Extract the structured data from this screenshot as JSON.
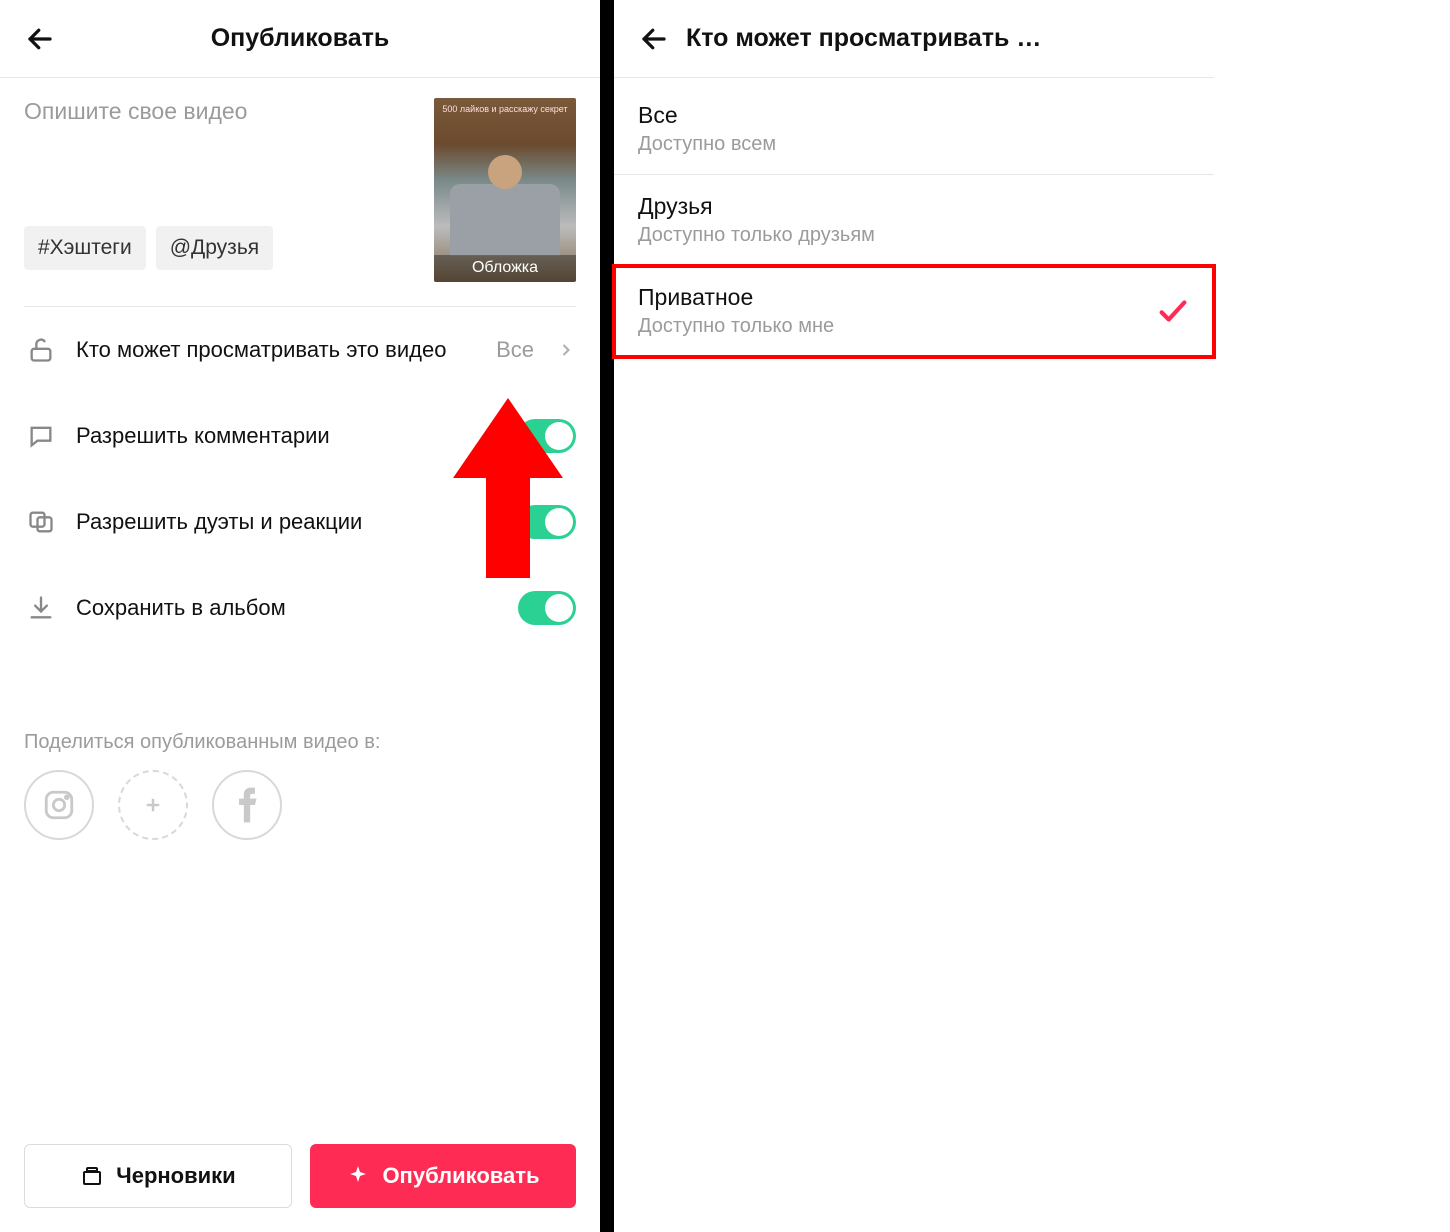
{
  "left": {
    "title": "Опубликовать",
    "desc_placeholder": "Опишите свое видео",
    "chips": {
      "hashtag": "#Хэштеги",
      "friends": "@Друзья"
    },
    "thumb": {
      "top_caption": "500 лайков и расскажу секрет",
      "overlay": "Обложка"
    },
    "rows": {
      "privacy": {
        "label": "Кто может просматривать это видео",
        "value": "Все"
      },
      "comments": {
        "label": "Разрешить комментарии"
      },
      "duet": {
        "label": "Разрешить дуэты и реакции"
      },
      "save": {
        "label": "Сохранить в альбом"
      }
    },
    "share_label": "Поделиться опубликованным видео в:",
    "buttons": {
      "drafts": "Черновики",
      "publish": "Опубликовать"
    }
  },
  "right": {
    "title": "Кто может просматривать …",
    "options": {
      "everyone": {
        "title": "Все",
        "sub": "Доступно всем"
      },
      "friends": {
        "title": "Друзья",
        "sub": "Доступно только друзьям"
      },
      "private": {
        "title": "Приватное",
        "sub": "Доступно только мне"
      }
    }
  },
  "annotation": {
    "arrow_color": "#ff0000"
  }
}
